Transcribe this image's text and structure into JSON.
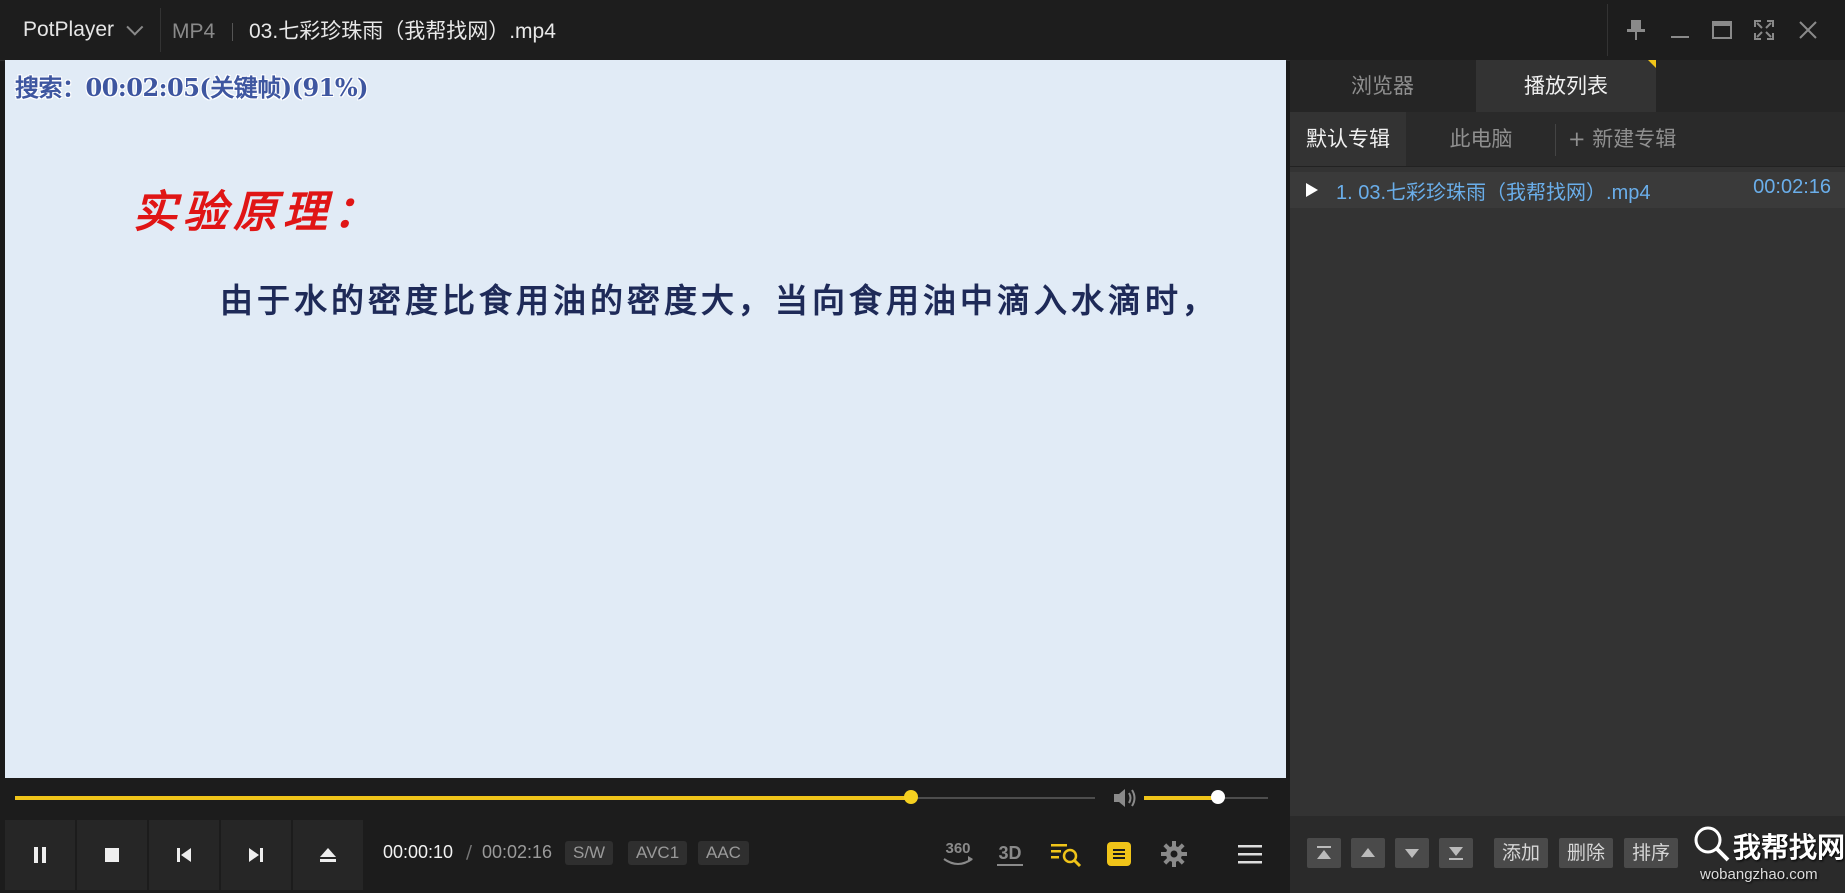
{
  "titlebar": {
    "app_name": "PotPlayer",
    "format": "MP4",
    "file_title": "03.七彩珍珠雨（我帮找网）.mp4"
  },
  "video": {
    "seek_osd": "搜索：00:02:05(关键帧)(91%)",
    "slide_title": "实验原理：",
    "slide_body": "由于水的密度比食用油的密度大，当向食用油中滴入水滴时，"
  },
  "controls": {
    "seek_progress": 0.83,
    "volume_level": 0.6,
    "time_current": "00:00:10",
    "time_separator": "/",
    "time_total": "00:02:16",
    "tags": [
      "S/W",
      "AVC1",
      "AAC"
    ],
    "icons": [
      "pause-icon",
      "stop-icon",
      "previous-icon",
      "next-icon",
      "eject-icon",
      "vr-360-icon",
      "3d-icon",
      "playlist-search-icon",
      "subtitle-icon",
      "settings-icon",
      "menu-icon"
    ],
    "accent_color": "#f0c419"
  },
  "playlist": {
    "tabs": [
      "浏览器",
      "播放列表"
    ],
    "albums": [
      "默认专辑",
      "此电脑",
      "+ 新建专辑"
    ],
    "items": [
      {
        "label": "1. 03.七彩珍珠雨（我帮找网）.mp4",
        "duration": "00:02:16"
      }
    ],
    "footer_buttons": [
      "添加",
      "删除",
      "排序"
    ],
    "item_color": "#6aaeea"
  },
  "watermark": {
    "cn": "我帮找网",
    "en": "wobangzhao.com"
  }
}
